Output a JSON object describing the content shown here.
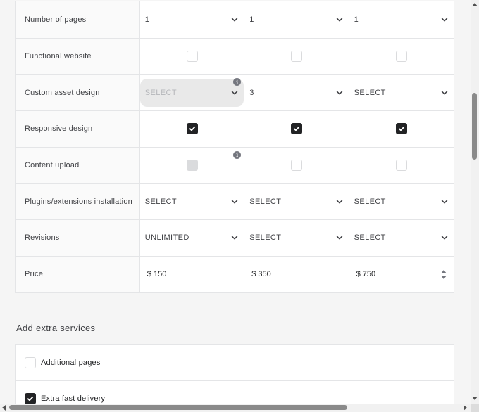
{
  "rows": [
    {
      "label": "Number of pages",
      "cells": [
        {
          "type": "select",
          "value": "1"
        },
        {
          "type": "select",
          "value": "1"
        },
        {
          "type": "select",
          "value": "1"
        }
      ]
    },
    {
      "label": "Functional website",
      "cells": [
        {
          "type": "checkbox",
          "checked": false
        },
        {
          "type": "checkbox",
          "checked": false
        },
        {
          "type": "checkbox",
          "checked": false
        }
      ]
    },
    {
      "label": "Custom asset design",
      "cells": [
        {
          "type": "select",
          "value": "SELECT",
          "disabled": true,
          "info": true
        },
        {
          "type": "select",
          "value": "3"
        },
        {
          "type": "select",
          "value": "SELECT"
        }
      ]
    },
    {
      "label": "Responsive design",
      "cells": [
        {
          "type": "checkbox",
          "checked": true
        },
        {
          "type": "checkbox",
          "checked": true
        },
        {
          "type": "checkbox",
          "checked": true
        }
      ]
    },
    {
      "label": "Content upload",
      "cells": [
        {
          "type": "checkbox",
          "checked": false,
          "disabled": true,
          "info": true
        },
        {
          "type": "checkbox",
          "checked": false
        },
        {
          "type": "checkbox",
          "checked": false
        }
      ]
    },
    {
      "label": "Plugins/extensions installation",
      "cells": [
        {
          "type": "select",
          "value": "SELECT"
        },
        {
          "type": "select",
          "value": "SELECT"
        },
        {
          "type": "select",
          "value": "SELECT"
        }
      ]
    },
    {
      "label": "Revisions",
      "cells": [
        {
          "type": "select",
          "value": "UNLIMITED"
        },
        {
          "type": "select",
          "value": "SELECT"
        },
        {
          "type": "select",
          "value": "SELECT"
        }
      ]
    },
    {
      "label": "Price",
      "cells": [
        {
          "type": "price",
          "value": "$ 150"
        },
        {
          "type": "price",
          "value": "$ 350"
        },
        {
          "type": "price",
          "value": "$ 750",
          "spinner": true
        }
      ]
    }
  ],
  "extras": {
    "title": "Add extra services",
    "items": [
      {
        "label": "Additional pages",
        "checked": false
      },
      {
        "label": "Extra fast delivery",
        "checked": true
      }
    ]
  },
  "icons": {
    "info": "info-icon",
    "chevron": "chevron-down-icon",
    "check": "check-icon"
  },
  "colors": {
    "checked": "#222325",
    "border": "#e4e5e7",
    "label_bg": "#fafafa"
  }
}
